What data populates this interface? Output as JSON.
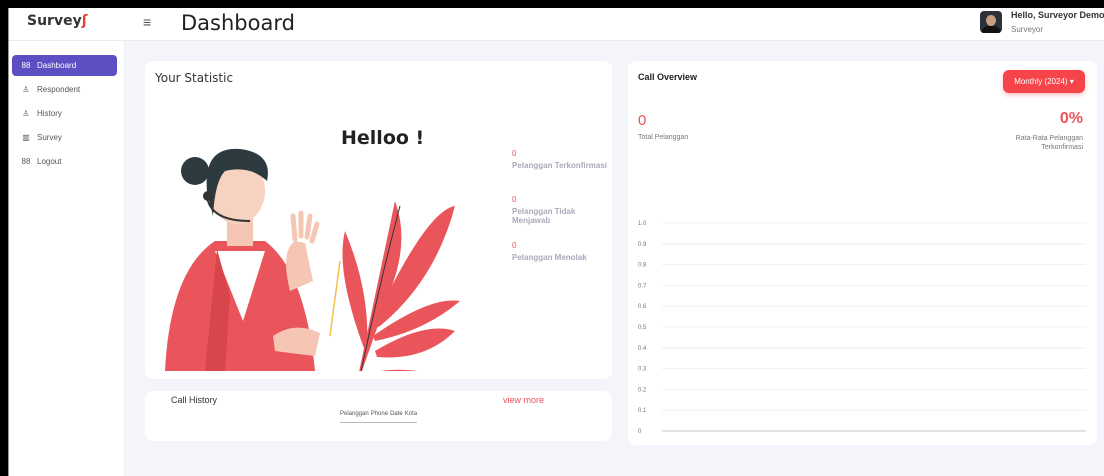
{
  "header": {
    "logo": "Survey",
    "title": "Dashboard",
    "greeting": "Hello, Surveyor Demo",
    "role": "Surveyor"
  },
  "sidebar": {
    "items": [
      {
        "label": "Dashboard",
        "icon": "grid-icon",
        "active": true
      },
      {
        "label": "Respondent",
        "icon": "user-icon",
        "active": false
      },
      {
        "label": "History",
        "icon": "user-icon",
        "active": false
      },
      {
        "label": "Survey",
        "icon": "columns-icon",
        "active": false
      },
      {
        "label": "Logout",
        "icon": "grid-icon",
        "active": false
      }
    ]
  },
  "statistic": {
    "title": "Your Statistic",
    "hello": "Helloo !",
    "items": [
      {
        "value": "0",
        "label": "Pelanggan Terkonfirmasi"
      },
      {
        "value": "0",
        "label": "Pelanggan Tidak Menjawab"
      },
      {
        "value": "0",
        "label": "Pelanggan Menolak"
      }
    ]
  },
  "call_history": {
    "title": "Call History",
    "view_more": "view more",
    "columns": [
      "Pelanggan",
      "Phone",
      "Date",
      "Kota"
    ]
  },
  "call_overview": {
    "title": "Call Overview",
    "period_button": "Monthly (2024) ▾",
    "total_value": "0",
    "total_label": "Total Pelanggan",
    "rate_value": "0%",
    "rate_label": "Rata-Rata Pelanggan Terkonfirmasi"
  },
  "colors": {
    "accent": "#5b4fc3",
    "danger": "#f5444a",
    "highlight": "#e9555a"
  },
  "chart_data": {
    "type": "line",
    "title": "",
    "xlabel": "",
    "ylabel": "",
    "ylim": [
      0,
      1
    ],
    "y_ticks": [
      "1.0",
      "0.9",
      "0.8",
      "0.7",
      "0.6",
      "0.5",
      "0.4",
      "0.3",
      "0.2",
      "0.1",
      "0"
    ],
    "series": [],
    "grid": true
  }
}
